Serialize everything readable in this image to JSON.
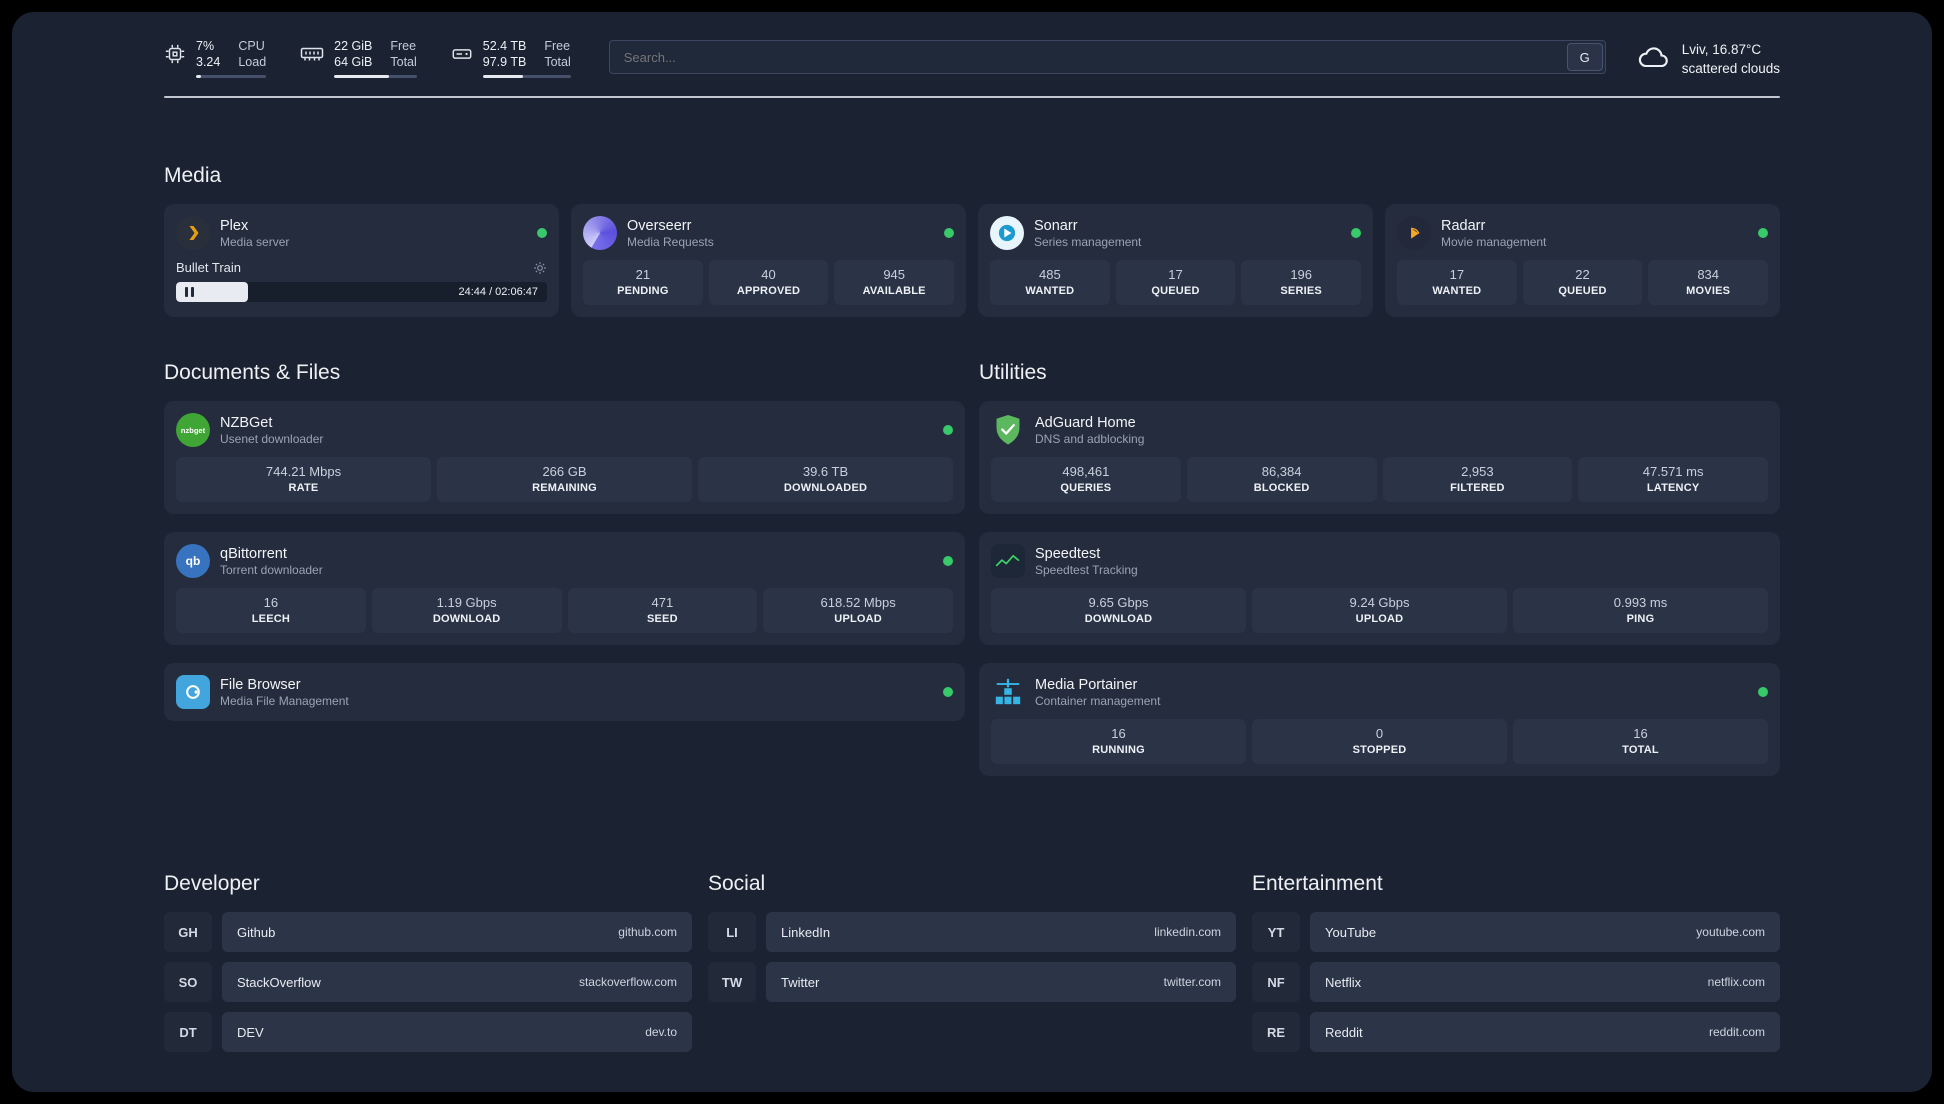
{
  "topbar": {
    "cpu": {
      "value": "7%",
      "sub": "3.24",
      "label_top": "CPU",
      "label_bottom": "Load",
      "progress_pct": 7
    },
    "ram": {
      "value": "22 GiB",
      "sub": "64 GiB",
      "label_top": "Free",
      "label_bottom": "Total",
      "progress_pct": 66
    },
    "disk": {
      "value": "52.4 TB",
      "sub": "97.9 TB",
      "label_top": "Free",
      "label_bottom": "Total",
      "progress_pct": 46
    },
    "search": {
      "placeholder": "Search...",
      "engine_button": "G"
    },
    "weather": {
      "location": "Lviv, 16.87°C",
      "condition": "scattered clouds"
    }
  },
  "media": {
    "title": "Media",
    "plex": {
      "name": "Plex",
      "desc": "Media server",
      "now_playing": "Bullet Train",
      "time": "24:44 / 02:06:47",
      "progress_pct": 19.5
    },
    "overseerr": {
      "name": "Overseerr",
      "desc": "Media Requests",
      "stats": [
        {
          "value": "21",
          "label": "PENDING"
        },
        {
          "value": "40",
          "label": "APPROVED"
        },
        {
          "value": "945",
          "label": "AVAILABLE"
        }
      ]
    },
    "sonarr": {
      "name": "Sonarr",
      "desc": "Series management",
      "stats": [
        {
          "value": "485",
          "label": "WANTED"
        },
        {
          "value": "17",
          "label": "QUEUED"
        },
        {
          "value": "196",
          "label": "SERIES"
        }
      ]
    },
    "radarr": {
      "name": "Radarr",
      "desc": "Movie management",
      "stats": [
        {
          "value": "17",
          "label": "WANTED"
        },
        {
          "value": "22",
          "label": "QUEUED"
        },
        {
          "value": "834",
          "label": "MOVIES"
        }
      ]
    }
  },
  "documents": {
    "title": "Documents & Files",
    "nzbget": {
      "name": "NZBGet",
      "desc": "Usenet downloader",
      "icon_text": "nzbget",
      "stats": [
        {
          "value": "744.21 Mbps",
          "label": "RATE"
        },
        {
          "value": "266 GB",
          "label": "REMAINING"
        },
        {
          "value": "39.6 TB",
          "label": "DOWNLOADED"
        }
      ]
    },
    "qbittorrent": {
      "name": "qBittorrent",
      "desc": "Torrent downloader",
      "icon_text": "qb",
      "stats": [
        {
          "value": "16",
          "label": "LEECH"
        },
        {
          "value": "1.19 Gbps",
          "label": "DOWNLOAD"
        },
        {
          "value": "471",
          "label": "SEED"
        },
        {
          "value": "618.52 Mbps",
          "label": "UPLOAD"
        }
      ]
    },
    "filebrowser": {
      "name": "File Browser",
      "desc": "Media File Management"
    }
  },
  "utilities": {
    "title": "Utilities",
    "adguard": {
      "name": "AdGuard Home",
      "desc": "DNS and adblocking",
      "stats": [
        {
          "value": "498,461",
          "label": "QUERIES"
        },
        {
          "value": "86,384",
          "label": "BLOCKED"
        },
        {
          "value": "2,953",
          "label": "FILTERED"
        },
        {
          "value": "47.571 ms",
          "label": "LATENCY"
        }
      ]
    },
    "speedtest": {
      "name": "Speedtest",
      "desc": "Speedtest Tracking",
      "stats": [
        {
          "value": "9.65 Gbps",
          "label": "DOWNLOAD"
        },
        {
          "value": "9.24 Gbps",
          "label": "UPLOAD"
        },
        {
          "value": "0.993 ms",
          "label": "PING"
        }
      ]
    },
    "portainer": {
      "name": "Media Portainer",
      "desc": "Container management",
      "stats": [
        {
          "value": "16",
          "label": "RUNNING"
        },
        {
          "value": "0",
          "label": "STOPPED"
        },
        {
          "value": "16",
          "label": "TOTAL"
        }
      ]
    }
  },
  "bookmarks": {
    "developer": {
      "title": "Developer",
      "items": [
        {
          "abbr": "GH",
          "name": "Github",
          "url": "github.com"
        },
        {
          "abbr": "SO",
          "name": "StackOverflow",
          "url": "stackoverflow.com"
        },
        {
          "abbr": "DT",
          "name": "DEV",
          "url": "dev.to"
        }
      ]
    },
    "social": {
      "title": "Social",
      "items": [
        {
          "abbr": "LI",
          "name": "LinkedIn",
          "url": "linkedin.com"
        },
        {
          "abbr": "TW",
          "name": "Twitter",
          "url": "twitter.com"
        }
      ]
    },
    "entertainment": {
      "title": "Entertainment",
      "items": [
        {
          "abbr": "YT",
          "name": "YouTube",
          "url": "youtube.com"
        },
        {
          "abbr": "NF",
          "name": "Netflix",
          "url": "netflix.com"
        },
        {
          "abbr": "RE",
          "name": "Reddit",
          "url": "reddit.com"
        }
      ]
    }
  },
  "colors": {
    "status_online_green": "#37c96a",
    "plex_gold": "#e5a00d",
    "adguard_green": "#5bb85e",
    "portainer_blue": "#36b5e5"
  }
}
